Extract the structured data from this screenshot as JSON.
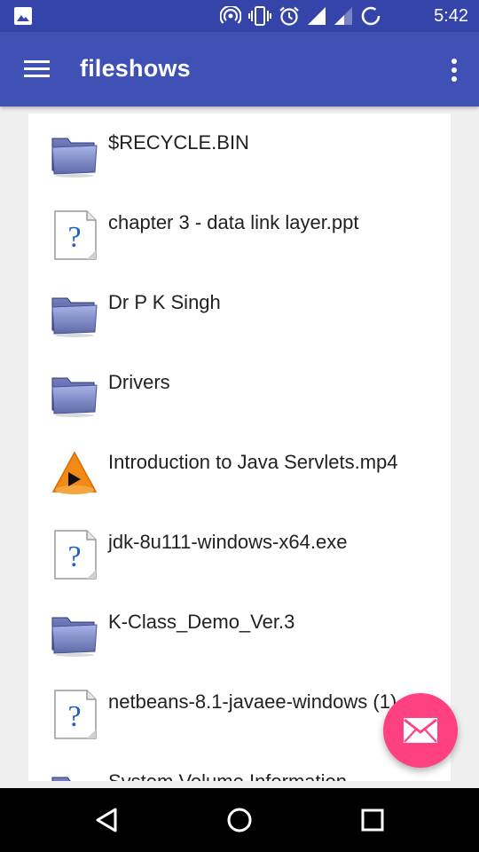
{
  "status_bar": {
    "time": "5:42",
    "icons": [
      "image-icon",
      "hotspot-icon",
      "vibrate-icon",
      "alarm-icon",
      "signal-icon",
      "signal-weak-icon",
      "sync-icon"
    ]
  },
  "app_bar": {
    "title": "fileshows",
    "menu_icon": "hamburger-menu-icon",
    "overflow_icon": "more-vert-icon"
  },
  "files": [
    {
      "name": "$RECYCLE.BIN",
      "type": "folder"
    },
    {
      "name": "chapter 3 - data link layer.ppt",
      "type": "unknown"
    },
    {
      "name": "Dr P K Singh",
      "type": "folder"
    },
    {
      "name": "Drivers",
      "type": "folder"
    },
    {
      "name": "Introduction to Java Servlets.mp4",
      "type": "video"
    },
    {
      "name": "jdk-8u111-windows-x64.exe",
      "type": "unknown"
    },
    {
      "name": "K-Class_Demo_Ver.3",
      "type": "folder"
    },
    {
      "name": "netbeans-8.1-javaee-windows (1).exe",
      "type": "unknown"
    },
    {
      "name": "System Volume Information",
      "type": "folder"
    }
  ],
  "fab": {
    "icon": "email-icon",
    "color": "#ff4081"
  },
  "colors": {
    "primary": "#3f51b5",
    "status": "#3544a8",
    "accent": "#ff4081"
  },
  "nav_bar": {
    "icons": [
      "back-icon",
      "home-icon",
      "recents-icon"
    ]
  }
}
